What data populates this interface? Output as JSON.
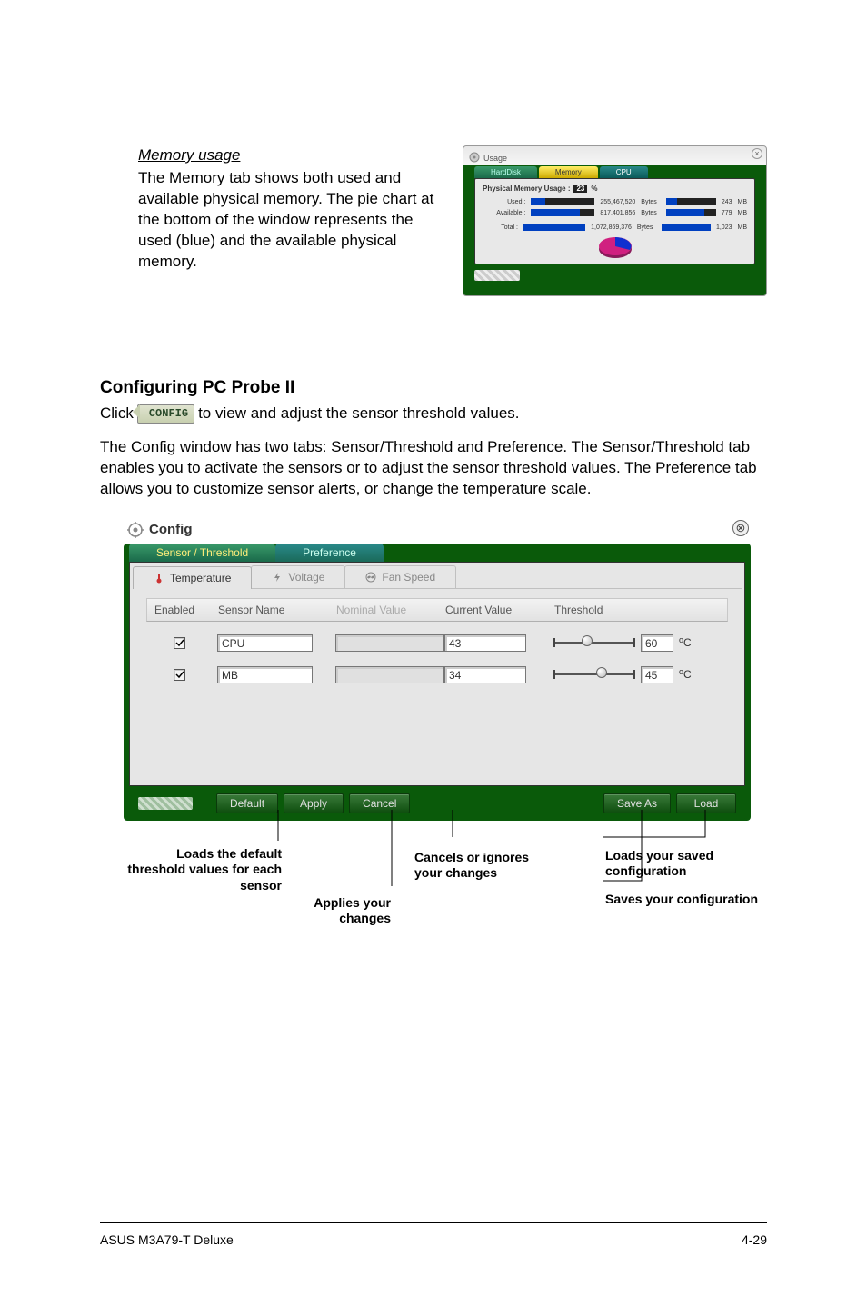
{
  "memory_section": {
    "heading": "Memory usage",
    "paragraph": "The Memory tab shows both used and available physical memory. The pie chart at the bottom of the window represents the used (blue) and the available physical memory."
  },
  "usage_window": {
    "title": "Usage",
    "tabs": {
      "hard": "HardDisk",
      "memory": "Memory",
      "cpu": "CPU"
    },
    "panel_label": "Physical Memory Usage :",
    "percent": "23",
    "percent_unit": "%",
    "rows": {
      "used": {
        "label": "Used :",
        "bytes": "255,467,520",
        "bytes_unit": "Bytes",
        "mb": "243",
        "mb_unit": "MB",
        "fill_pct": 23
      },
      "available": {
        "label": "Available :",
        "bytes": "817,401,856",
        "bytes_unit": "Bytes",
        "mb": "779",
        "mb_unit": "MB",
        "fill_pct": 77
      },
      "total": {
        "label": "Total :",
        "bytes": "1,072,869,376",
        "bytes_unit": "Bytes",
        "mb": "1,023",
        "mb_unit": "MB",
        "fill_pct": 100
      }
    }
  },
  "chart_data": {
    "type": "pie",
    "title": "Physical Memory Usage",
    "series": [
      {
        "name": "Used",
        "value": 23,
        "color": "#1030d0"
      },
      {
        "name": "Available",
        "value": 77,
        "color": "#d02080"
      }
    ]
  },
  "configuring": {
    "heading": "Configuring PC Probe II",
    "click_prefix": "Click",
    "badge": "CONFIG",
    "click_suffix": "to view and adjust the sensor threshold values.",
    "paragraph": "The Config window has two tabs: Sensor/Threshold and Preference. The Sensor/Threshold tab enables you to activate the sensors or to adjust the sensor threshold values. The Preference tab allows you to customize sensor alerts, or change the temperature scale."
  },
  "config_window": {
    "title": "Config",
    "outer_tabs": {
      "active": "Sensor / Threshold",
      "inactive": "Preference"
    },
    "sub_tabs": {
      "temperature": "Temperature",
      "voltage": "Voltage",
      "fan": "Fan Speed"
    },
    "columns": {
      "enabled": "Enabled",
      "sensor_name": "Sensor Name",
      "nominal": "Nominal Value",
      "current": "Current Value",
      "threshold": "Threshold"
    },
    "rows": [
      {
        "name": "CPU",
        "current": "43",
        "threshold": "60",
        "unit_deg": "o",
        "unit_c": "C",
        "thumb_pct": 34
      },
      {
        "name": "MB",
        "current": "34",
        "threshold": "45",
        "unit_deg": "o",
        "unit_c": "C",
        "thumb_pct": 52
      }
    ],
    "buttons": {
      "default": "Default",
      "apply": "Apply",
      "cancel": "Cancel",
      "save_as": "Save As",
      "load": "Load"
    }
  },
  "callouts": {
    "default": "Loads the default threshold values for each sensor",
    "apply": "Applies your changes",
    "cancel": "Cancels or ignores your changes",
    "load": "Loads your saved configuration",
    "save": "Saves your configuration"
  },
  "footer": {
    "left": "ASUS M3A79-T Deluxe",
    "right": "4-29"
  }
}
